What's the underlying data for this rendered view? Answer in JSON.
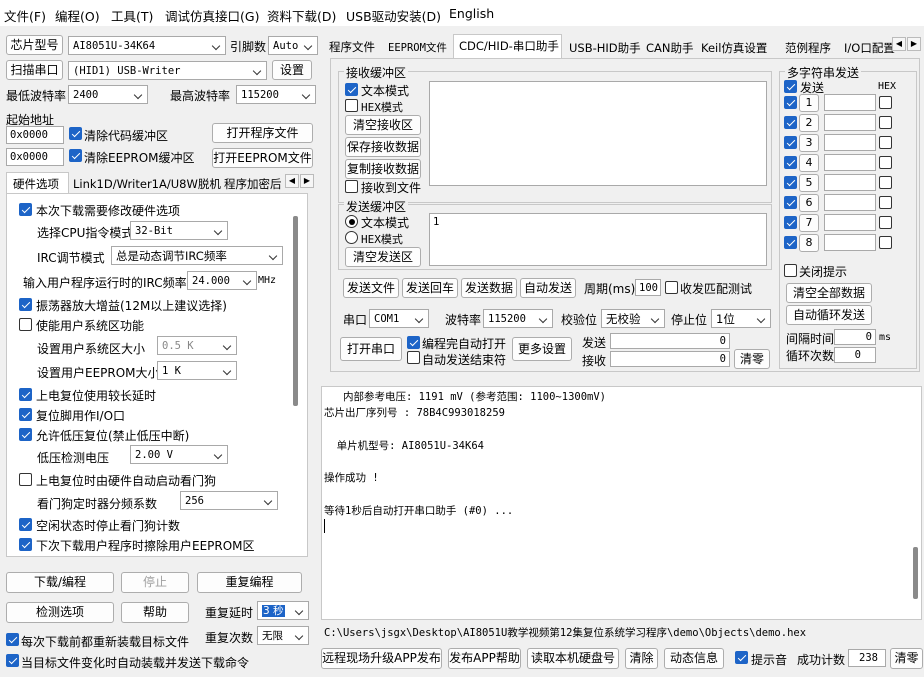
{
  "menu": [
    "文件(F)",
    "编程(O)",
    "工具(T)",
    "调试仿真接口(G)",
    "资料下载(D)",
    "USB驱动安装(D)",
    "English"
  ],
  "left": {
    "chip_model_btn": "芯片型号",
    "chip_model": "AI8051U-34K64",
    "pin_label": "引脚数",
    "pin_value": "Auto",
    "scan_port_btn": "扫描串口",
    "port_value": "(HID1) USB-Writer",
    "settings_btn": "设置",
    "min_baud_label": "最低波特率",
    "min_baud": "2400",
    "max_baud_label": "最高波特率",
    "max_baud": "115200",
    "start_addr_label": "起始地址",
    "code_addr": "0x0000",
    "clear_code_label": "清除代码缓冲区",
    "open_prog_btn": "打开程序文件",
    "eeprom_addr": "0x0000",
    "clear_eeprom_label": "清除EEPROM缓冲区",
    "open_eeprom_btn": "打开EEPROM文件",
    "tabs": [
      "硬件选项",
      "Link1D/Writer1A/U8W脱机",
      "程序加密后"
    ],
    "hw": {
      "opt1": "本次下载需要修改硬件选项",
      "cpu_mode_label": "选择CPU指令模式",
      "cpu_mode": "32-Bit",
      "irc_mode_label": "IRC调节模式",
      "irc_mode": "总是动态调节IRC频率",
      "irc_freq_label": "输入用户程序运行时的IRC频率",
      "irc_freq": "24.000",
      "irc_unit": "MHz",
      "osc_gain": "振荡器放大增益(12M以上建议选择)",
      "user_sys": "使能用户系统区功能",
      "user_sys_size_label": "设置用户系统区大小",
      "user_sys_size": "0.5 K",
      "user_eeprom_label": "设置用户EEPROM大小",
      "user_eeprom": "1   K",
      "long_delay": "上电复位使用较长延时",
      "reset_pin": "复位脚用作I/O口",
      "lvr": "允许低压复位(禁止低压中断)",
      "lvd_label": "低压检测电压",
      "lvd": "2.00 V",
      "wdt_auto": "上电复位时由硬件自动启动看门狗",
      "wdt_div_label": "看门狗定时器分频系数",
      "wdt_div": "256",
      "idle_wdt": "空闲状态时停止看门狗计数",
      "erase_eeprom": "下次下载用户程序时擦除用户EEPROM区"
    },
    "download_btn": "下载/编程",
    "stop_btn": "停止",
    "reprog_btn": "重复编程",
    "check_btn": "检测选项",
    "help_btn": "帮助",
    "repeat_delay_label": "重复延时",
    "repeat_delay": "3 秒",
    "repeat_count_label": "重复次数",
    "repeat_count": "无限",
    "reload_label": "每次下载前都重新装载目标文件",
    "auto_send_label": "当目标文件变化时自动装载并发送下载命令"
  },
  "right": {
    "tabs": [
      "程序文件",
      "EEPROM文件",
      "CDC/HID-串口助手",
      "USB-HID助手",
      "CAN助手",
      "Keil仿真设置",
      "范例程序",
      "I/O口配置"
    ],
    "rx": {
      "title": "接收缓冲区",
      "text_mode": "文本模式",
      "hex_mode": "HEX模式",
      "clear": "清空接收区",
      "save": "保存接收数据",
      "copy": "复制接收数据",
      "to_file": "接收到文件"
    },
    "tx": {
      "title": "发送缓冲区",
      "text_mode": "文本模式",
      "hex_mode": "HEX模式",
      "clear": "清空发送区",
      "content": "1"
    },
    "send_file": "发送文件",
    "send_enter": "发送回车",
    "send_data": "发送数据",
    "auto_send": "自动发送",
    "period_label": "周期(ms)",
    "period": "100",
    "match_label": "收发匹配测试",
    "port_label": "串口",
    "port": "COM1",
    "baud_label": "波特率",
    "baud": "115200",
    "parity_label": "校验位",
    "parity": "无校验",
    "stop_label": "停止位",
    "stop": "1位",
    "open_port": "打开串口",
    "auto_open": "编程完自动打开",
    "auto_stop": "自动发送结束符",
    "more": "更多设置",
    "sent_label": "发送",
    "sent": "0",
    "recv_label": "接收",
    "recv": "0",
    "clear_count": "清零",
    "multi": {
      "title": "多字符串发送",
      "send": "发送",
      "hex": "HEX",
      "rows": [
        "1",
        "2",
        "3",
        "4",
        "5",
        "6",
        "7",
        "8"
      ],
      "close_tip": "关闭提示",
      "clear_all": "清空全部数据",
      "auto_loop": "自动循环发送",
      "interval_label": "间隔时间",
      "interval": "0",
      "interval_unit": "ms",
      "loop_label": "循环次数",
      "loop": "0"
    }
  },
  "log": [
    "   内部参考电压: 1191 mV (参考范围: 1100~1300mV)",
    "芯片出厂序列号 : 78B4C993018259",
    "",
    "  单片机型号: AI8051U-34K64",
    "",
    "操作成功 !",
    "",
    "等待1秒后自动打开串口助手 (#0) ..."
  ],
  "path": "C:\\Users\\jsgx\\Desktop\\AI8051U教学视频第12集复位系统学习程序\\demo\\Objects\\demo.hex",
  "bottom": {
    "remote_upgrade": "远程现场升级APP发布",
    "publish_help": "发布APP帮助",
    "read_disk": "读取本机硬盘号",
    "clear": "清除",
    "dyn_info": "动态信息",
    "beep_label": "提示音",
    "success_label": "成功计数",
    "success": "238",
    "clear2": "清零"
  }
}
